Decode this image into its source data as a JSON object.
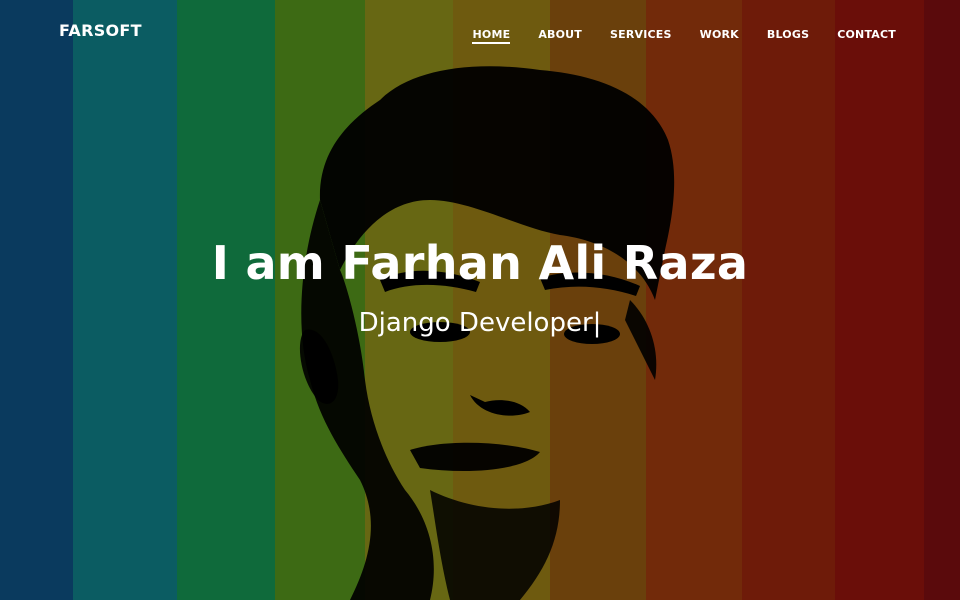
{
  "brand": {
    "name": "FARSOFT"
  },
  "nav": {
    "items": [
      {
        "label": "HOME",
        "active": true
      },
      {
        "label": "ABOUT",
        "active": false
      },
      {
        "label": "SERVICES",
        "active": false
      },
      {
        "label": "WORK",
        "active": false
      },
      {
        "label": "BLOGS",
        "active": false
      },
      {
        "label": "CONTACT",
        "active": false
      }
    ]
  },
  "hero": {
    "title": "I am Farhan Ali Raza",
    "subtitle": "Django Developer|"
  },
  "colors": {
    "stripes": [
      "#0a3a5e",
      "#0b5c62",
      "#0f6a3b",
      "#3d6a14",
      "#676713",
      "#6e5a0f",
      "#6a400c",
      "#722a0a",
      "#6e1b09",
      "#6a0e09",
      "#5a0a0c"
    ]
  },
  "icons": {
    "background": "portrait-photo"
  }
}
